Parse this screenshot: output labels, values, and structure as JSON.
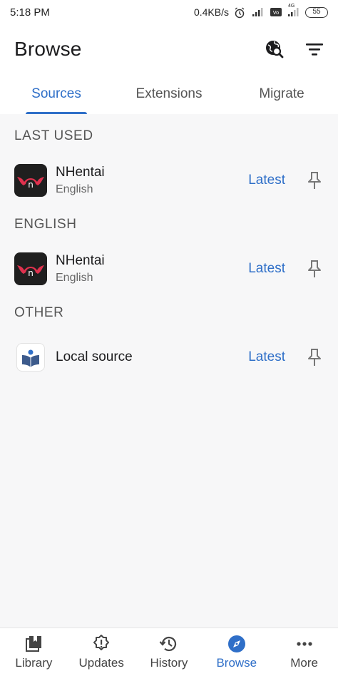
{
  "status_bar": {
    "time": "5:18 PM",
    "speed": "0.4KB/s",
    "network_badge": "4G",
    "battery": "55"
  },
  "header": {
    "title": "Browse",
    "icons": [
      "globe-search-icon",
      "filter-icon"
    ]
  },
  "tabs": [
    {
      "label": "Sources",
      "active": true
    },
    {
      "label": "Extensions",
      "active": false
    },
    {
      "label": "Migrate",
      "active": false
    }
  ],
  "sections": [
    {
      "title": "LAST USED",
      "sources": [
        {
          "name": "NHentai",
          "language": "English",
          "action": "Latest",
          "icon": "nhentai-logo-icon"
        }
      ]
    },
    {
      "title": "ENGLISH",
      "sources": [
        {
          "name": "NHentai",
          "language": "English",
          "action": "Latest",
          "icon": "nhentai-logo-icon"
        }
      ]
    },
    {
      "title": "OTHER",
      "sources": [
        {
          "name": "Local source",
          "language": "",
          "action": "Latest",
          "icon": "local-source-book-icon"
        }
      ]
    }
  ],
  "bottom_nav": [
    {
      "label": "Library",
      "icon": "library-icon",
      "active": false
    },
    {
      "label": "Updates",
      "icon": "updates-icon",
      "active": false
    },
    {
      "label": "History",
      "icon": "history-icon",
      "active": false
    },
    {
      "label": "Browse",
      "icon": "compass-icon",
      "active": true
    },
    {
      "label": "More",
      "icon": "more-icon",
      "active": false
    }
  ],
  "colors": {
    "accent": "#2f6fc8",
    "background": "#f7f7f8",
    "text_primary": "#1c1c1e",
    "text_secondary": "#666666"
  }
}
